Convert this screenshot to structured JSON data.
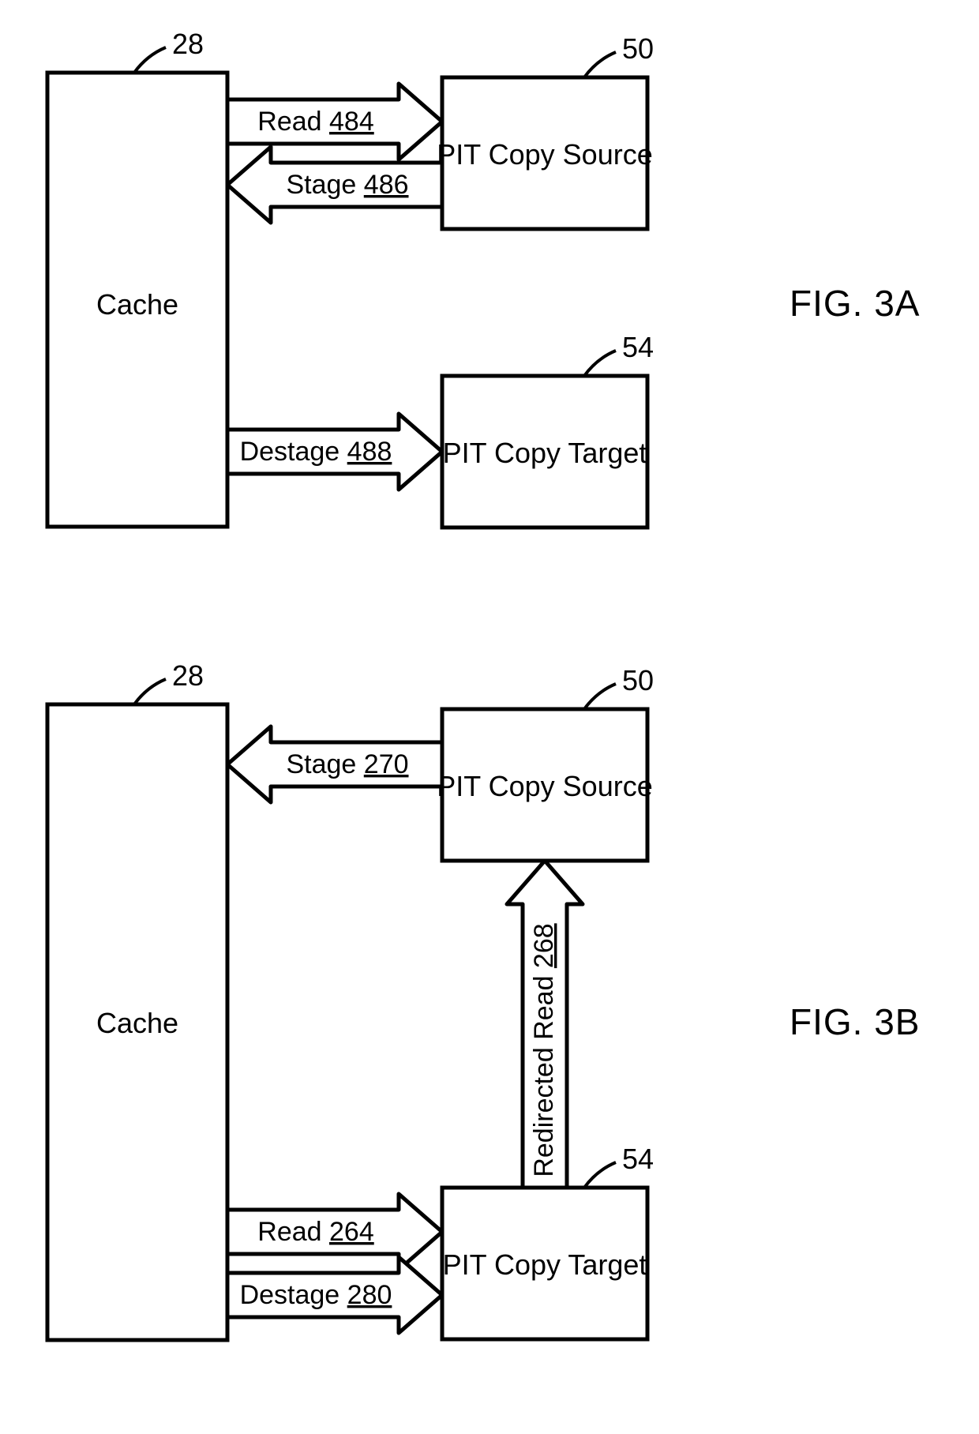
{
  "figA": {
    "title": "FIG. 3A",
    "cache": {
      "label": "Cache",
      "ref": "28"
    },
    "source": {
      "label": "PIT Copy Source",
      "ref": "50"
    },
    "target": {
      "label": "PIT Copy Target",
      "ref": "54"
    },
    "arrows": {
      "read": {
        "word": "Read",
        "num": "484"
      },
      "stage": {
        "word": "Stage",
        "num": "486"
      },
      "destage": {
        "word": "Destage",
        "num": "488"
      }
    }
  },
  "figB": {
    "title": "FIG. 3B",
    "cache": {
      "label": "Cache",
      "ref": "28"
    },
    "source": {
      "label": "PIT Copy Source",
      "ref": "50"
    },
    "target": {
      "label": "PIT Copy Target",
      "ref": "54"
    },
    "arrows": {
      "stage": {
        "word": "Stage",
        "num": "270"
      },
      "read": {
        "word": "Read",
        "num": "264"
      },
      "destage": {
        "word": "Destage",
        "num": "280"
      },
      "redirect": {
        "word": "Redirected Read",
        "num": "268"
      }
    }
  }
}
